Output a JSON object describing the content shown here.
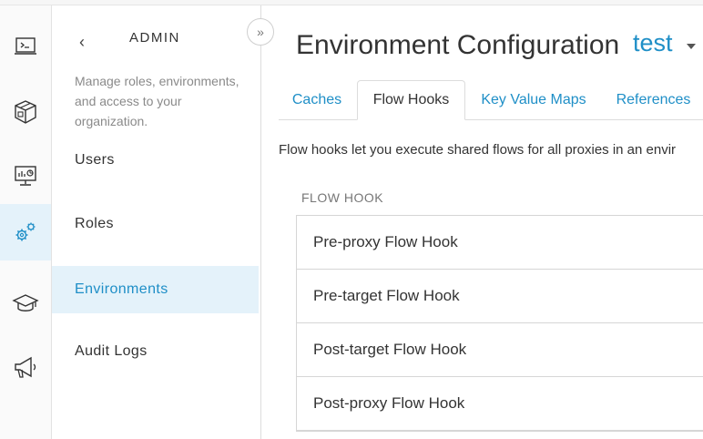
{
  "rail": {
    "items": [
      {
        "icon": "terminal-icon"
      },
      {
        "icon": "package-icon"
      },
      {
        "icon": "analytics-monitor-icon"
      },
      {
        "icon": "gears-icon",
        "active": true
      },
      {
        "icon": "graduation-cap-icon"
      },
      {
        "icon": "megaphone-icon"
      }
    ]
  },
  "panel": {
    "title": "ADMIN",
    "back_glyph": "‹",
    "description": "Manage roles, environments, and access to your organization.",
    "items": [
      {
        "label": "Users"
      },
      {
        "label": "Roles"
      },
      {
        "label": "Environments",
        "active": true
      },
      {
        "label": "Audit Logs"
      }
    ]
  },
  "collapse_glyph": "»",
  "header": {
    "title": "Environment Configuration",
    "environment": "test"
  },
  "tabs": [
    {
      "label": "Caches"
    },
    {
      "label": "Flow Hooks",
      "active": true
    },
    {
      "label": "Key Value Maps"
    },
    {
      "label": "References"
    }
  ],
  "content": {
    "description": "Flow hooks let you execute shared flows for all proxies in an envir",
    "section_label": "FLOW HOOK",
    "hooks": [
      {
        "label": "Pre-proxy Flow Hook"
      },
      {
        "label": "Pre-target Flow Hook"
      },
      {
        "label": "Post-target Flow Hook"
      },
      {
        "label": "Post-proxy Flow Hook"
      }
    ]
  },
  "colors": {
    "accent": "#1f8fc7",
    "active_bg": "#e4f2fa",
    "text": "#333333",
    "muted": "#8a8a8a",
    "border": "#dcdcdc"
  }
}
